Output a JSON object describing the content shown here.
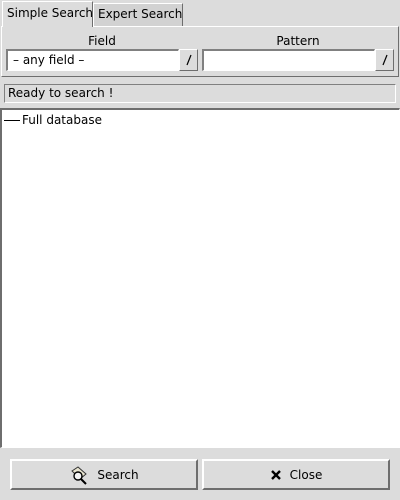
{
  "tabs": [
    {
      "label": "Simple Search",
      "active": true
    },
    {
      "label": "Expert Search",
      "active": false
    }
  ],
  "search_form": {
    "field": {
      "label": "Field",
      "value": "– any field –"
    },
    "pattern": {
      "label": "Pattern",
      "value": ""
    },
    "dropdown_icon": "slash-arrow-icon"
  },
  "status": {
    "text": "Ready to search !"
  },
  "tree": {
    "root_label": "Full database"
  },
  "buttons": {
    "search": {
      "label": "Search",
      "icon": "magnifier-icon"
    },
    "close": {
      "label": "Close",
      "icon": "close-x-icon"
    }
  }
}
